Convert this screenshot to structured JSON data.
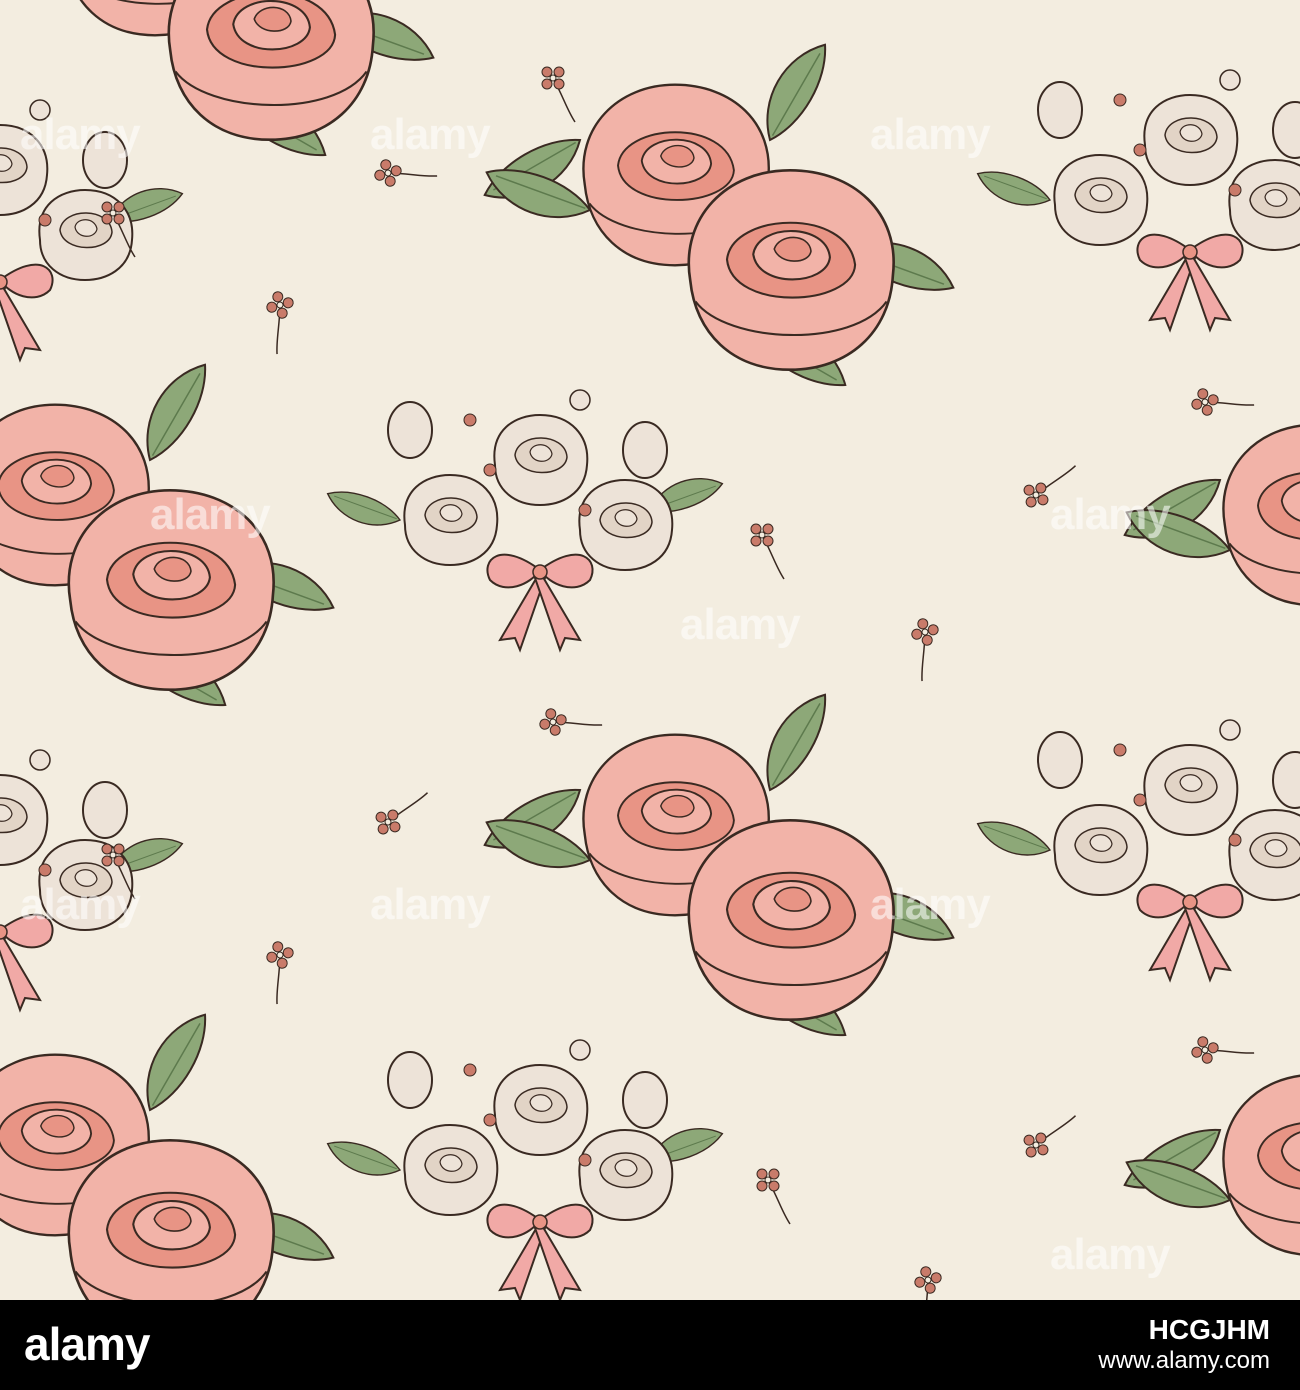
{
  "palette": {
    "background": "#f3ede0",
    "rose_pink": "#f2b3a8",
    "rose_pink_dark": "#e89485",
    "rose_cream": "#ede3d8",
    "leaf": "#8da878",
    "leaf_dark": "#5d7a4d",
    "bud": "#c97b6a",
    "ribbon": "#f1a9a6",
    "ink": "#3a2a22",
    "footer_bg": "#000000"
  },
  "icons": {
    "large_rose_cluster": "pink-rose-pair-icon",
    "cream_bouquet": "cream-rose-bouquet-icon",
    "small_flower": "tiny-flower-icon"
  },
  "watermark": {
    "text": "alamy"
  },
  "footer": {
    "logo": "alamy",
    "image_id": "HCGJHM",
    "url": "www.alamy.com"
  }
}
